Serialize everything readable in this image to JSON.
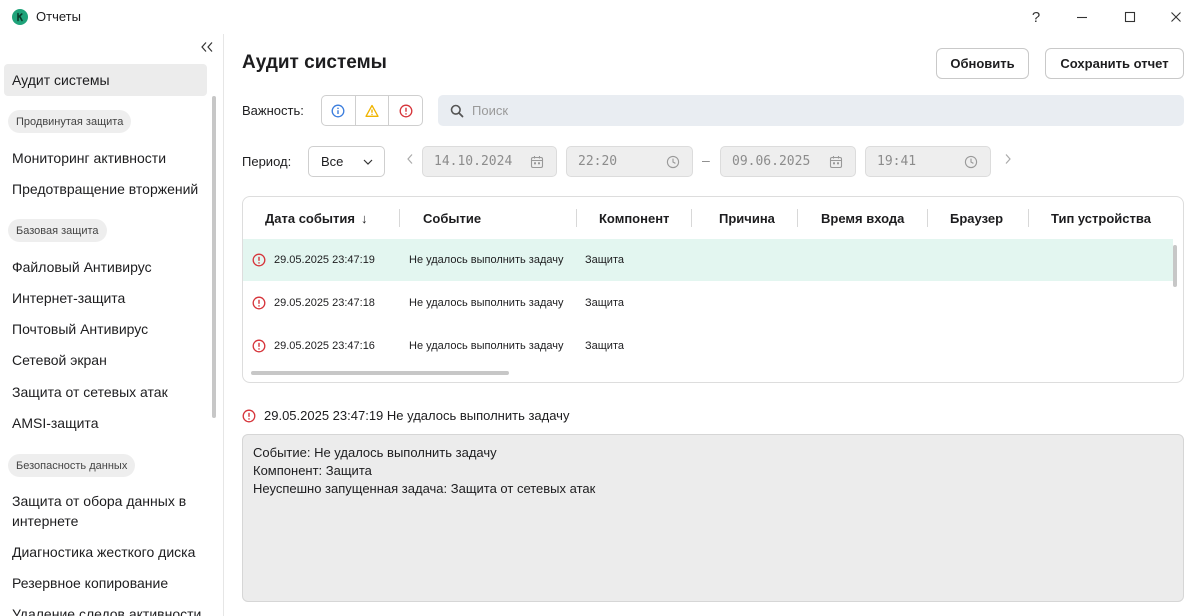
{
  "window": {
    "title": "Отчеты",
    "help_label": "?",
    "minimize_icon": "minimize-icon",
    "maximize_icon": "maximize-icon",
    "close_icon": "close-icon"
  },
  "sidebar": {
    "active_item": "Аудит системы",
    "groups": [
      {
        "label": "Продвинутая защита",
        "items": [
          "Мониторинг активности",
          "Предотвращение вторжений"
        ]
      },
      {
        "label": "Базовая защита",
        "items": [
          "Файловый Антивирус",
          "Интернет-защита",
          "Почтовый Антивирус",
          "Сетевой экран",
          "Защита от сетевых атак",
          "AMSI-защита"
        ]
      },
      {
        "label": "Безопасность данных",
        "items": [
          "Защита от обора данных в интернете",
          "Диагностика жесткого диска",
          "Резервное копирование",
          "Удаление следов активности"
        ]
      }
    ]
  },
  "main": {
    "title": "Аудит системы",
    "refresh_label": "Обновить",
    "save_report_label": "Сохранить отчет",
    "severity_label": "Важность:",
    "search_placeholder": "Поиск",
    "period_label": "Период:",
    "period_value": "Все",
    "date_from": "14.10.2024",
    "time_from": "22:20",
    "date_to": "09.06.2025",
    "time_to": "19:41",
    "range_dash": "–"
  },
  "table": {
    "columns": [
      "Дата события",
      "Событие",
      "Компонент",
      "Причина",
      "Время входа",
      "Браузер",
      "Тип устройства"
    ],
    "sort_arrow": "↓",
    "rows": [
      {
        "date": "29.05.2025 23:47:19",
        "event": "Не удалось выполнить задачу",
        "component": "Защита",
        "severity": "error",
        "selected": true
      },
      {
        "date": "29.05.2025 23:47:18",
        "event": "Не удалось выполнить задачу",
        "component": "Защита",
        "severity": "error",
        "selected": false
      },
      {
        "date": "29.05.2025 23:47:16",
        "event": "Не удалось выполнить задачу",
        "component": "Защита",
        "severity": "error",
        "selected": false
      }
    ]
  },
  "detail": {
    "header": "29.05.2025 23:47:19 Не удалось выполнить задачу",
    "lines": [
      "Событие: Не удалось выполнить задачу",
      "Компонент: Защита",
      "Неуспешно запущенная задача: Защита от сетевых атак"
    ]
  },
  "colors": {
    "brand": "#1fa37a",
    "selected_row": "#e3f6f0",
    "info": "#3b7ddd",
    "warning": "#f0b400",
    "error": "#d6343a"
  }
}
